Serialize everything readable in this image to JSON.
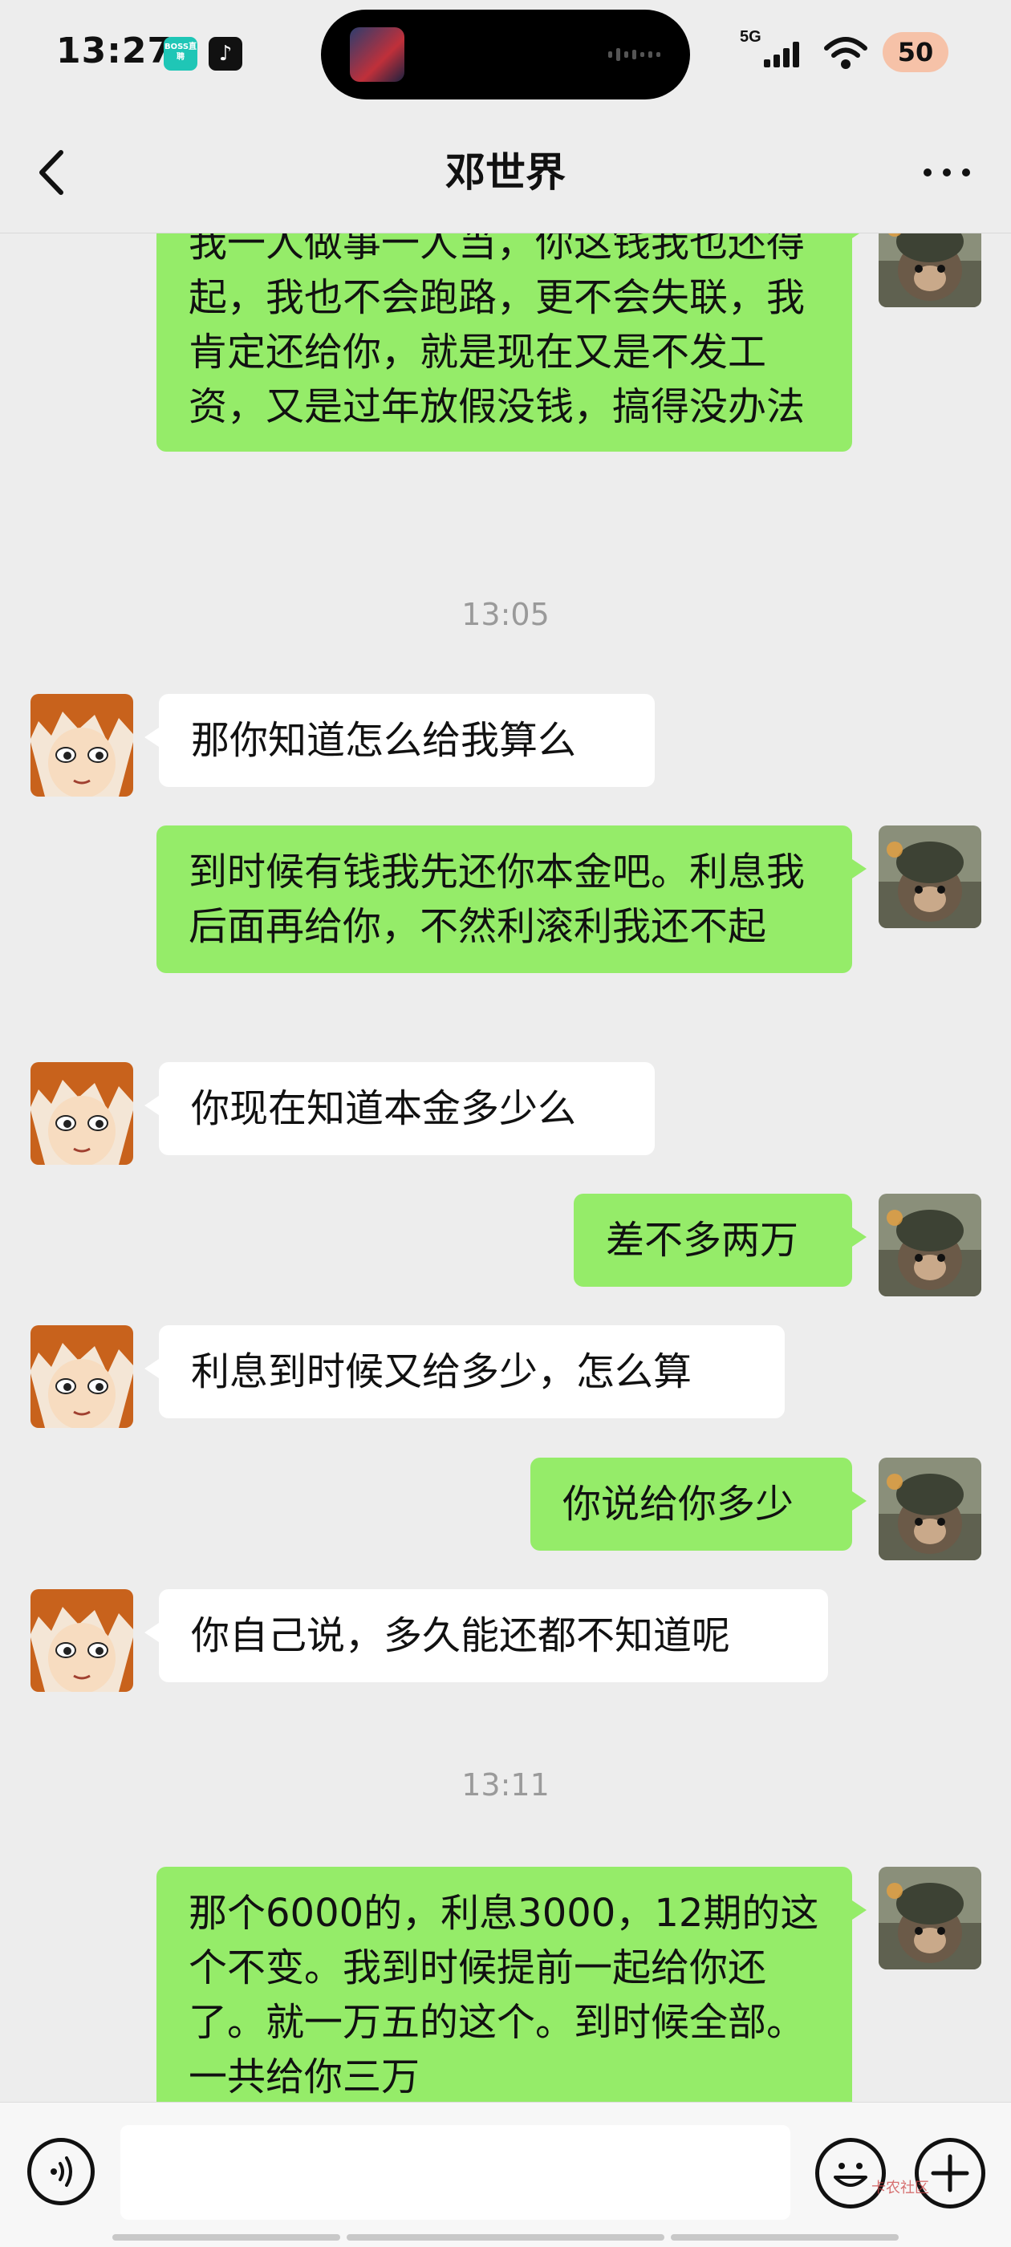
{
  "status": {
    "time": "13:27",
    "boss_badge": "BOSS直聘",
    "network": "5G",
    "battery": "50"
  },
  "nav": {
    "title": "邓世界"
  },
  "messages": [
    {
      "side": "me",
      "text": "我一人做事一人当，你这钱我也还得起，我也不会跑路，更不会失联，我肯定还给你，就是现在又是不发工资，又是过年放假没钱，搞得没办法"
    },
    {
      "type": "time",
      "text": "13:05"
    },
    {
      "side": "them",
      "text": "那你知道怎么给我算么"
    },
    {
      "side": "me",
      "text": "到时候有钱我先还你本金吧。利息我后面再给你，不然利滚利我还不起"
    },
    {
      "side": "them",
      "text": "你现在知道本金多少么"
    },
    {
      "side": "me",
      "text": "差不多两万"
    },
    {
      "side": "them",
      "text": "利息到时候又给多少，怎么算"
    },
    {
      "side": "me",
      "text": "你说给你多少"
    },
    {
      "side": "them",
      "text": "你自己说，多久能还都不知道呢"
    },
    {
      "type": "time",
      "text": "13:11"
    },
    {
      "side": "me",
      "text": "那个6000的，利息3000，12期的这个不变。我到时候提前一起给你还了。就一万五的这个。到时候全部。一共给你三万"
    }
  ],
  "watermark": "卡农社区",
  "colors": {
    "my_bubble": "#95ec69",
    "their_bubble": "#ffffff",
    "background": "#ededed"
  }
}
